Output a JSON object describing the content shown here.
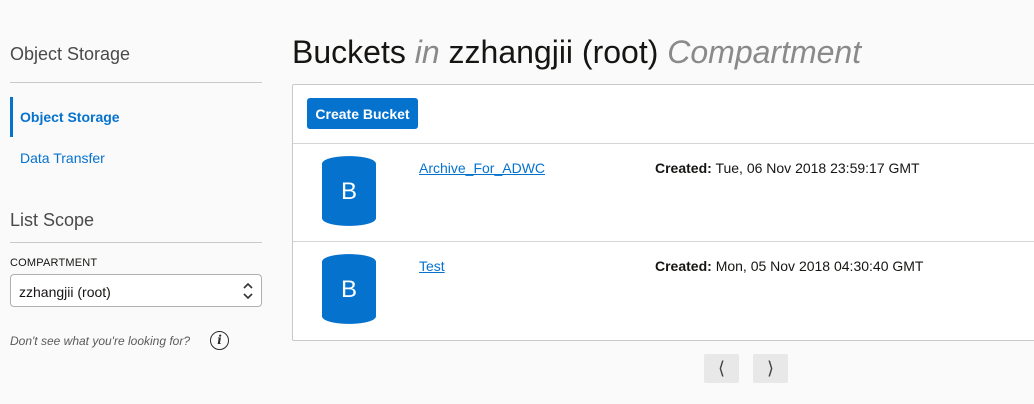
{
  "sidebar": {
    "title": "Object Storage",
    "nav": [
      {
        "label": "Object Storage",
        "active": true
      },
      {
        "label": "Data Transfer",
        "active": false
      }
    ],
    "scope_title": "List Scope",
    "compartment_label": "COMPARTMENT",
    "compartment_value": "zzhangjii (root)",
    "help_text": "Don't see what you're looking for?",
    "help_icon": "i"
  },
  "main": {
    "title_prefix": "Buckets",
    "title_in": "in",
    "title_compartment": "zzhangjii (root)",
    "title_suffix": "Compartment",
    "create_button": "Create Bucket",
    "created_label": "Created:",
    "buckets": [
      {
        "icon_letter": "B",
        "name": "Archive_For_ADWC",
        "created": "Tue, 06 Nov 2018 23:59:17 GMT"
      },
      {
        "icon_letter": "B",
        "name": "Test",
        "created": "Mon, 05 Nov 2018 04:30:40 GMT"
      }
    ],
    "pager": {
      "prev": "⟨",
      "next": "⟩"
    }
  },
  "colors": {
    "accent": "#0572ce",
    "background": "#fafafa",
    "muted_text": "#8a8a8a"
  }
}
